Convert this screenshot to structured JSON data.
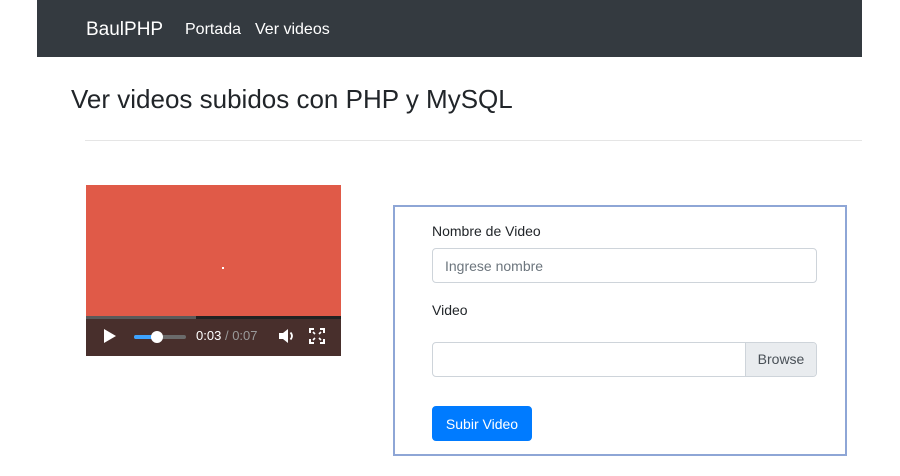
{
  "navbar": {
    "brand": "BaulPHP",
    "links": [
      {
        "label": "Portada"
      },
      {
        "label": "Ver videos"
      }
    ],
    "bg_color": "#343a40"
  },
  "page": {
    "title": "Ver videos subidos con PHP y MySQL"
  },
  "video_player": {
    "thumbnail_color": "#e05a48",
    "current_time": "0:03",
    "separator": "/",
    "duration": "0:07",
    "playback_progress": 0.43,
    "volume_level": 0.45,
    "icons": [
      "play-icon",
      "speaker-icon",
      "fullscreen-icon"
    ]
  },
  "form": {
    "name_label": "Nombre de Video",
    "name_placeholder": "Ingrese nombre",
    "name_value": "",
    "video_label": "Video",
    "file_value": "",
    "browse_label": "Browse",
    "submit_label": "Subir Video",
    "accent_color": "#007bff"
  }
}
